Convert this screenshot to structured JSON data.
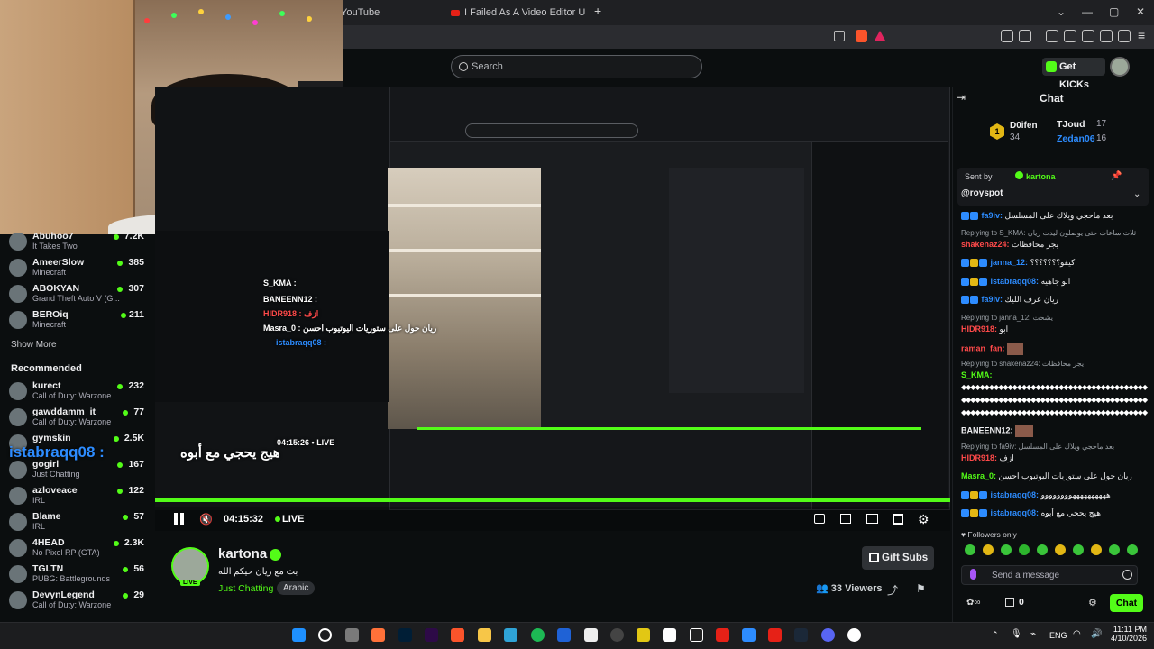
{
  "browser": {
    "tab1": "YouTube",
    "tab2": "I Failed As A Video Editor Until I Und"
  },
  "header": {
    "search_placeholder": "Search",
    "get_kicks": "Get KICKs"
  },
  "sidebar": {
    "following": [
      {
        "name": "Abuhoo7",
        "sub": "It Takes Two",
        "count": "7.2K"
      },
      {
        "name": "AmeerSlow",
        "sub": "Minecraft",
        "count": "385"
      },
      {
        "name": "ABOKYAN",
        "sub": "Grand Theft Auto V (G...",
        "count": "307"
      },
      {
        "name": "BEROiq",
        "sub": "Minecraft",
        "count": "211"
      }
    ],
    "show_more": "Show More",
    "recommended_title": "Recommended",
    "recommended": [
      {
        "name": "kurect",
        "sub": "Call of Duty: Warzone",
        "count": "232"
      },
      {
        "name": "gawddamm_it",
        "sub": "Call of Duty: Warzone",
        "count": "77"
      },
      {
        "name": "gymskin",
        "sub": "",
        "count": "2.5K"
      },
      {
        "name": "gogirl",
        "sub": "Just Chatting",
        "count": "167"
      },
      {
        "name": "azloveace",
        "sub": "IRL",
        "count": "122"
      },
      {
        "name": "Blame",
        "sub": "IRL",
        "count": "57"
      },
      {
        "name": "4HEAD",
        "sub": "No Pixel RP (GTA)",
        "count": "2.3K"
      },
      {
        "name": "TGLTN",
        "sub": "PUBG: Battlegrounds",
        "count": "56"
      },
      {
        "name": "DevynLegend",
        "sub": "Call of Duty: Warzone",
        "count": "29"
      }
    ]
  },
  "video": {
    "time": "04:15:32",
    "live": "LIVE",
    "nested_time": "04:15:26",
    "nested_live": "LIVE",
    "overlay_user": "istabraqq08 :",
    "overlay_msg": "هيج يحجي مع أبوه",
    "nested_chat": [
      "S_KMA :",
      "BANEENN12 :",
      "HIDR918 : ازف",
      "Masra_0 : ريان حول على ستوريات اليوتيوب احسن",
      "istabraqq08 :"
    ]
  },
  "channel": {
    "name": "kartona",
    "title": "بث مع ريان حيكم الله",
    "category": "Just Chatting",
    "language": "Arabic",
    "gift_subs": "Gift Subs",
    "viewers_count": "33",
    "viewers_label": "Viewers"
  },
  "chat": {
    "title": "Chat",
    "leaderboard": [
      {
        "name": "D0ifen",
        "count": "34",
        "rank": "1"
      },
      {
        "name": "TJoud",
        "count": "17"
      },
      {
        "name": "Zedan06",
        "count": "16"
      }
    ],
    "pinned": {
      "sent_by_label": "Sent by",
      "sender": "kartona",
      "mention": "@royspot"
    },
    "messages": [
      {
        "user": "fa9iv:",
        "text": "بعد ماحجي ويلاك على المسلسل"
      },
      {
        "reply": "Replying to S_KMA: ثلاث ساعات حتى يوصلون ليدت ريان"
      },
      {
        "user": "shakenaz24:",
        "text": "يجر محافظات"
      },
      {
        "user": "janna_12:",
        "text": "كيفو؟؟؟؟؟؟؟"
      },
      {
        "user": "istabraqq08:",
        "text": "ابو جاهيه"
      },
      {
        "user": "fa9iv:",
        "text": "ريان عرف الليك"
      },
      {
        "reply": "Replying to janna_12: يشحت"
      },
      {
        "user": "HIDR918:",
        "text": "ابو"
      },
      {
        "user": "raman_fan:",
        "text": ""
      },
      {
        "reply": "Replying to shakenaz24: يجر محافظات"
      },
      {
        "user": "S_KMA:",
        "text": ""
      },
      {
        "user": "BANEENN12:",
        "text": ""
      },
      {
        "reply": "Replying to fa9iv: بعد ماحجي ويلاك على المسلسل"
      },
      {
        "user": "HIDR918:",
        "text": "ازف"
      },
      {
        "user": "Masra_0:",
        "text": "ريان حول على ستوريات اليوتيوب احسن"
      },
      {
        "user": "istabraqq08:",
        "text": "ههههههههههوووووووو"
      },
      {
        "user": "istabraqq08:",
        "text": "هيج يحجي مع أبوه"
      }
    ],
    "followers_only": "Followers only",
    "input_placeholder": "Send a message",
    "points": "0",
    "send_button": "Chat"
  },
  "taskbar": {
    "lang": "ENG",
    "time": "11:11 PM",
    "date": "4/10/2026"
  },
  "colors": {
    "kick_green": "#53fc18",
    "background": "#0b0e0f"
  }
}
